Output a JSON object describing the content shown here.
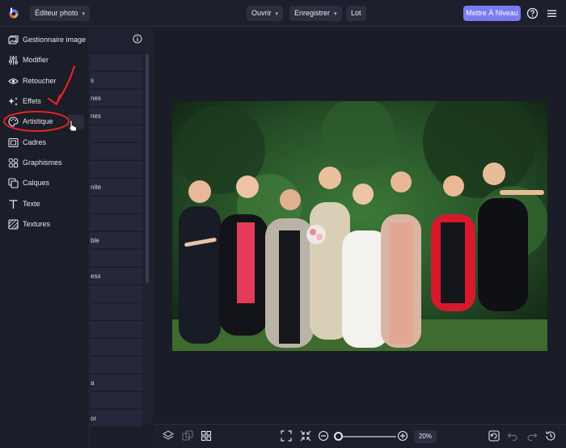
{
  "topbar": {
    "app_menu_label": "Éditeur photo",
    "open_label": "Ouvrir",
    "save_label": "Enregistrer",
    "batch_label": "Lot",
    "upgrade_label": "Mettre À Niveau"
  },
  "rail": {
    "items": [
      {
        "label": "Gestionnaire image",
        "icon": "image-manager-icon"
      },
      {
        "label": "Modifier",
        "icon": "sliders-icon"
      },
      {
        "label": "Retoucher",
        "icon": "eye-icon"
      },
      {
        "label": "Effets",
        "icon": "sparkles-icon"
      },
      {
        "label": "Artistique",
        "icon": "palette-icon"
      },
      {
        "label": "Cadres",
        "icon": "frame-icon"
      },
      {
        "label": "Graphismes",
        "icon": "shapes-icon"
      },
      {
        "label": "Calques",
        "icon": "layers-icon"
      },
      {
        "label": "Texte",
        "icon": "text-icon"
      },
      {
        "label": "Textures",
        "icon": "textures-icon"
      }
    ]
  },
  "panel": {
    "visible_fragments": [
      "s",
      "nes",
      "nes",
      "nite",
      "ble",
      "ess",
      "a",
      "or"
    ]
  },
  "zoom": {
    "value_label": "20%",
    "level": 0.2
  },
  "colors": {
    "accent": "#7b7bf0",
    "annotation_red": "#e02424",
    "background": "#1b1d29"
  }
}
